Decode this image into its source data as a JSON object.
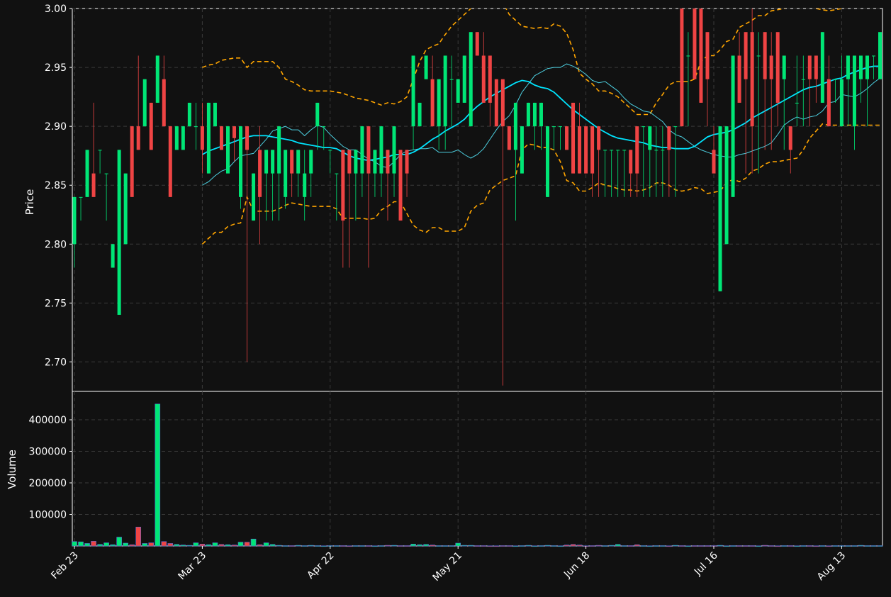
{
  "chart_data": {
    "type": "candlestick",
    "colors": {
      "background": "#111111",
      "up": "#00e676",
      "down": "#ef4444",
      "ma_fast": "#00e5ff",
      "ma_slow": "#4dd0e1",
      "bands": "#ffa500",
      "grid": "#3a3a3a",
      "axis": "#ffffff"
    },
    "x_ticks": [
      "Feb 23",
      "Mar 23",
      "Apr 22",
      "May 21",
      "Jun 18",
      "Jul 16",
      "Aug 13"
    ],
    "x_tick_index": [
      0,
      20,
      40,
      60,
      80,
      100,
      120
    ],
    "price_axis": {
      "label": "Price",
      "ylim": [
        2.675,
        3.0
      ],
      "ticks": [
        "2.70",
        "2.75",
        "2.80",
        "2.85",
        "2.90",
        "2.95",
        "3.00"
      ],
      "tick_values": [
        2.7,
        2.75,
        2.8,
        2.85,
        2.9,
        2.95,
        3.0
      ]
    },
    "volume_axis": {
      "label": "Volume",
      "ylim": [
        0,
        490000
      ],
      "ticks": [
        "100000",
        "200000",
        "300000",
        "400000"
      ],
      "tick_values": [
        100000,
        200000,
        300000,
        400000
      ]
    },
    "grid": true,
    "n_bars": 127,
    "candles": [
      [
        2.8,
        2.84,
        2.78,
        2.84
      ],
      [
        2.84,
        2.84,
        2.82,
        2.84
      ],
      [
        2.84,
        2.88,
        2.84,
        2.88
      ],
      [
        2.86,
        2.92,
        2.84,
        2.84
      ],
      [
        2.88,
        2.88,
        2.86,
        2.88
      ],
      [
        2.86,
        2.86,
        2.82,
        2.86
      ],
      [
        2.78,
        2.8,
        2.78,
        2.8
      ],
      [
        2.74,
        2.88,
        2.74,
        2.88
      ],
      [
        2.8,
        2.86,
        2.8,
        2.86
      ],
      [
        2.9,
        2.9,
        2.84,
        2.84
      ],
      [
        2.9,
        2.96,
        2.88,
        2.88
      ],
      [
        2.9,
        2.94,
        2.9,
        2.94
      ],
      [
        2.92,
        2.92,
        2.88,
        2.88
      ],
      [
        2.92,
        2.96,
        2.92,
        2.96
      ],
      [
        2.94,
        2.96,
        2.9,
        2.9
      ],
      [
        2.9,
        2.9,
        2.84,
        2.84
      ],
      [
        2.88,
        2.9,
        2.88,
        2.9
      ],
      [
        2.88,
        2.9,
        2.88,
        2.9
      ],
      [
        2.9,
        2.92,
        2.9,
        2.92
      ],
      [
        2.9,
        2.92,
        2.88,
        2.9
      ],
      [
        2.9,
        2.92,
        2.86,
        2.88
      ],
      [
        2.86,
        2.92,
        2.86,
        2.92
      ],
      [
        2.9,
        2.92,
        2.9,
        2.92
      ],
      [
        2.9,
        2.9,
        2.88,
        2.88
      ],
      [
        2.86,
        2.9,
        2.86,
        2.9
      ],
      [
        2.9,
        2.9,
        2.87,
        2.89
      ],
      [
        2.84,
        2.9,
        2.83,
        2.9
      ],
      [
        2.9,
        2.9,
        2.7,
        2.88
      ],
      [
        2.82,
        2.86,
        2.82,
        2.86
      ],
      [
        2.88,
        2.9,
        2.8,
        2.84
      ],
      [
        2.86,
        2.88,
        2.82,
        2.88
      ],
      [
        2.86,
        2.88,
        2.82,
        2.88
      ],
      [
        2.86,
        2.9,
        2.82,
        2.9
      ],
      [
        2.84,
        2.88,
        2.83,
        2.88
      ],
      [
        2.88,
        2.88,
        2.84,
        2.86
      ],
      [
        2.86,
        2.88,
        2.84,
        2.88
      ],
      [
        2.84,
        2.88,
        2.82,
        2.86
      ],
      [
        2.86,
        2.88,
        2.84,
        2.88
      ],
      [
        2.9,
        2.92,
        2.88,
        2.92
      ],
      [
        2.9,
        2.9,
        2.88,
        2.9
      ],
      [
        2.88,
        2.88,
        2.86,
        2.88
      ],
      [
        2.86,
        2.86,
        2.82,
        2.86
      ],
      [
        2.88,
        2.88,
        2.78,
        2.82
      ],
      [
        2.88,
        2.88,
        2.78,
        2.86
      ],
      [
        2.86,
        2.88,
        2.82,
        2.88
      ],
      [
        2.86,
        2.9,
        2.84,
        2.9
      ],
      [
        2.9,
        2.9,
        2.78,
        2.86
      ],
      [
        2.86,
        2.88,
        2.84,
        2.88
      ],
      [
        2.86,
        2.9,
        2.84,
        2.9
      ],
      [
        2.88,
        2.88,
        2.82,
        2.86
      ],
      [
        2.86,
        2.9,
        2.84,
        2.9
      ],
      [
        2.88,
        2.88,
        2.82,
        2.82
      ],
      [
        2.88,
        2.88,
        2.84,
        2.86
      ],
      [
        2.9,
        2.96,
        2.88,
        2.96
      ],
      [
        2.9,
        2.92,
        2.9,
        2.92
      ],
      [
        2.94,
        2.96,
        2.94,
        2.96
      ],
      [
        2.94,
        2.96,
        2.9,
        2.9
      ],
      [
        2.9,
        2.94,
        2.88,
        2.94
      ],
      [
        2.9,
        2.96,
        2.88,
        2.96
      ],
      [
        2.94,
        2.96,
        2.9,
        2.94
      ],
      [
        2.92,
        2.94,
        2.92,
        2.94
      ],
      [
        2.92,
        2.96,
        2.92,
        2.96
      ],
      [
        2.9,
        2.98,
        2.9,
        2.98
      ],
      [
        2.98,
        2.98,
        2.96,
        2.96
      ],
      [
        2.96,
        2.98,
        2.92,
        2.92
      ],
      [
        2.96,
        2.96,
        2.9,
        2.92
      ],
      [
        2.94,
        2.94,
        2.9,
        2.9
      ],
      [
        2.94,
        2.94,
        2.68,
        2.9
      ],
      [
        2.9,
        2.9,
        2.88,
        2.88
      ],
      [
        2.88,
        2.92,
        2.82,
        2.92
      ],
      [
        2.86,
        2.9,
        2.86,
        2.9
      ],
      [
        2.9,
        2.92,
        2.9,
        2.92
      ],
      [
        2.9,
        2.92,
        2.88,
        2.92
      ],
      [
        2.9,
        2.92,
        2.88,
        2.92
      ],
      [
        2.84,
        2.9,
        2.84,
        2.9
      ],
      [
        2.9,
        2.9,
        2.88,
        2.9
      ],
      [
        2.9,
        2.9,
        2.88,
        2.9
      ],
      [
        2.9,
        2.9,
        2.88,
        2.88
      ],
      [
        2.92,
        2.92,
        2.86,
        2.86
      ],
      [
        2.9,
        2.92,
        2.86,
        2.86
      ],
      [
        2.9,
        2.9,
        2.86,
        2.86
      ],
      [
        2.9,
        2.9,
        2.84,
        2.86
      ],
      [
        2.9,
        2.9,
        2.84,
        2.88
      ],
      [
        2.88,
        2.88,
        2.84,
        2.88
      ],
      [
        2.88,
        2.88,
        2.84,
        2.88
      ],
      [
        2.88,
        2.88,
        2.84,
        2.88
      ],
      [
        2.88,
        2.88,
        2.84,
        2.88
      ],
      [
        2.88,
        2.88,
        2.84,
        2.86
      ],
      [
        2.9,
        2.9,
        2.84,
        2.86
      ],
      [
        2.9,
        2.9,
        2.84,
        2.9
      ],
      [
        2.88,
        2.9,
        2.84,
        2.9
      ],
      [
        2.88,
        2.9,
        2.84,
        2.88
      ],
      [
        2.88,
        2.9,
        2.84,
        2.88
      ],
      [
        2.9,
        2.9,
        2.84,
        2.88
      ],
      [
        2.9,
        2.9,
        2.84,
        2.9
      ],
      [
        3.0,
        3.0,
        2.9,
        2.9
      ],
      [
        2.96,
        2.98,
        2.9,
        2.96
      ],
      [
        3.0,
        3.0,
        2.94,
        2.94
      ],
      [
        3.0,
        3.0,
        2.92,
        2.92
      ],
      [
        2.98,
        2.98,
        2.9,
        2.94
      ],
      [
        2.88,
        2.9,
        2.86,
        2.86
      ],
      [
        2.76,
        2.9,
        2.76,
        2.9
      ],
      [
        2.8,
        2.9,
        2.8,
        2.9
      ],
      [
        2.84,
        2.96,
        2.84,
        2.96
      ],
      [
        2.96,
        2.98,
        2.92,
        2.92
      ],
      [
        2.98,
        2.98,
        2.86,
        2.94
      ],
      [
        2.98,
        3.0,
        2.86,
        2.9
      ],
      [
        2.96,
        2.98,
        2.86,
        2.96
      ],
      [
        2.98,
        2.98,
        2.88,
        2.94
      ],
      [
        2.96,
        2.98,
        2.88,
        2.94
      ],
      [
        2.98,
        2.98,
        2.9,
        2.92
      ],
      [
        2.94,
        2.96,
        2.88,
        2.96
      ],
      [
        2.9,
        2.9,
        2.86,
        2.88
      ],
      [
        2.92,
        2.96,
        2.9,
        2.92
      ],
      [
        2.94,
        2.96,
        2.9,
        2.94
      ],
      [
        2.96,
        2.96,
        2.9,
        2.94
      ],
      [
        2.96,
        2.96,
        2.92,
        2.94
      ],
      [
        2.92,
        2.98,
        2.92,
        2.98
      ],
      [
        2.94,
        2.96,
        2.9,
        2.9
      ],
      [
        2.94,
        2.94,
        2.92,
        2.94
      ],
      [
        2.9,
        2.96,
        2.9,
        2.94
      ],
      [
        2.94,
        2.96,
        2.9,
        2.96
      ],
      [
        2.9,
        2.96,
        2.88,
        2.96
      ],
      [
        2.94,
        2.96,
        2.92,
        2.96
      ],
      [
        2.94,
        2.96,
        2.9,
        2.96
      ],
      [
        2.96,
        2.96,
        2.94,
        2.96
      ],
      [
        2.94,
        2.98,
        2.94,
        2.98
      ]
    ],
    "volume": [
      14000,
      13000,
      8000,
      15000,
      5000,
      10000,
      4000,
      28000,
      9000,
      4000,
      60000,
      8000,
      10000,
      450000,
      14000,
      8000,
      5000,
      3000,
      2000,
      10000,
      6000,
      4000,
      10000,
      5000,
      4000,
      3000,
      12000,
      12000,
      22000,
      4000,
      10000,
      5000,
      2000,
      1000,
      1000,
      2000,
      1000,
      2000,
      1000,
      500,
      1000,
      1000,
      1000,
      500,
      1000,
      1000,
      1000,
      500,
      1000,
      2000,
      2000,
      1000,
      1000,
      6000,
      4000,
      5000,
      3000,
      1000,
      1000,
      1000,
      9000,
      2000,
      2000,
      1000,
      1000,
      500,
      500,
      1000,
      1000,
      500,
      1000,
      2000,
      500,
      1000,
      2000,
      1000,
      500,
      3000,
      5000,
      3000,
      500,
      1000,
      2000,
      1000,
      2000,
      5000,
      1000,
      1000,
      4000,
      1000,
      500,
      1000,
      1000,
      500,
      2000,
      1000,
      500,
      1000,
      1000,
      1000,
      1000,
      2000,
      500,
      1000,
      1000,
      1000,
      1000,
      500,
      2000,
      1000,
      500,
      1000,
      1000,
      500,
      1000,
      1000,
      500,
      1000,
      500,
      1000,
      1000,
      1000,
      1000,
      2000,
      1000,
      1000,
      1000
    ],
    "ma_fast": [
      null,
      null,
      null,
      null,
      null,
      null,
      null,
      null,
      null,
      null,
      null,
      null,
      null,
      null,
      null,
      null,
      null,
      null,
      null,
      null,
      2.876,
      2.879,
      2.881,
      2.883,
      2.885,
      2.887,
      2.889,
      2.891,
      2.892,
      2.892,
      2.892,
      2.891,
      2.89,
      2.889,
      2.888,
      2.886,
      2.885,
      2.884,
      2.883,
      2.882,
      2.882,
      2.881,
      2.878,
      2.875,
      2.873,
      2.872,
      2.871,
      2.872,
      2.873,
      2.874,
      2.876,
      2.876,
      2.876,
      2.878,
      2.881,
      2.885,
      2.889,
      2.892,
      2.896,
      2.899,
      2.902,
      2.906,
      2.912,
      2.917,
      2.921,
      2.925,
      2.928,
      2.931,
      2.934,
      2.937,
      2.939,
      2.938,
      2.935,
      2.933,
      2.932,
      2.929,
      2.924,
      2.919,
      2.914,
      2.91,
      2.906,
      2.902,
      2.898,
      2.895,
      2.892,
      2.89,
      2.889,
      2.888,
      2.887,
      2.886,
      2.884,
      2.883,
      2.882,
      2.882,
      2.881,
      2.881,
      2.881,
      2.883,
      2.887,
      2.891,
      2.893,
      2.894,
      2.895,
      2.897,
      2.9,
      2.903,
      2.907,
      2.91,
      2.913,
      2.916,
      2.919,
      2.922,
      2.925,
      2.928,
      2.931,
      2.933,
      2.934,
      2.936,
      2.938,
      2.94,
      2.941,
      2.944,
      2.946,
      2.948,
      2.95,
      2.951,
      2.951
    ],
    "ma_slow": [
      null,
      null,
      null,
      null,
      null,
      null,
      null,
      null,
      null,
      null,
      null,
      null,
      null,
      null,
      null,
      null,
      null,
      null,
      null,
      null,
      2.85,
      2.853,
      2.858,
      2.862,
      2.864,
      2.87,
      2.875,
      2.876,
      2.877,
      2.883,
      2.889,
      2.896,
      2.898,
      2.9,
      2.897,
      2.897,
      2.892,
      2.897,
      2.901,
      2.899,
      2.893,
      2.888,
      2.883,
      2.88,
      2.88,
      2.876,
      2.872,
      2.87,
      2.866,
      2.865,
      2.87,
      2.876,
      2.879,
      2.88,
      2.881,
      2.881,
      2.882,
      2.878,
      2.878,
      2.878,
      2.88,
      2.876,
      2.873,
      2.876,
      2.881,
      2.889,
      2.897,
      2.904,
      2.909,
      2.918,
      2.929,
      2.936,
      2.943,
      2.946,
      2.949,
      2.95,
      2.95,
      2.953,
      2.951,
      2.948,
      2.944,
      2.939,
      2.937,
      2.938,
      2.934,
      2.93,
      2.924,
      2.919,
      2.916,
      2.913,
      2.912,
      2.908,
      2.904,
      2.897,
      2.893,
      2.891,
      2.887,
      2.883,
      2.88,
      2.878,
      2.876,
      2.875,
      2.874,
      2.874,
      2.876,
      2.877,
      2.879,
      2.881,
      2.883,
      2.886,
      2.893,
      2.901,
      2.905,
      2.908,
      2.906,
      2.908,
      2.909,
      2.913,
      2.92,
      2.921,
      2.927,
      2.926,
      2.925,
      2.928,
      2.932,
      2.937,
      2.941
    ],
    "band_upper": [
      null,
      null,
      null,
      null,
      null,
      null,
      null,
      null,
      null,
      null,
      null,
      null,
      null,
      null,
      null,
      null,
      null,
      null,
      null,
      null,
      2.95,
      2.952,
      2.953,
      2.956,
      2.957,
      2.958,
      2.958,
      2.95,
      2.955,
      2.955,
      2.955,
      2.955,
      2.95,
      2.94,
      2.938,
      2.935,
      2.931,
      2.93,
      2.93,
      2.93,
      2.93,
      2.929,
      2.928,
      2.926,
      2.924,
      2.923,
      2.922,
      2.92,
      2.918,
      2.92,
      2.919,
      2.921,
      2.925,
      2.94,
      2.955,
      2.965,
      2.968,
      2.97,
      2.978,
      2.985,
      2.99,
      2.995,
      3.0,
      3.005,
      3.01,
      3.014,
      3.012,
      3.005,
      2.995,
      2.99,
      2.985,
      2.984,
      2.983,
      2.984,
      2.983,
      2.987,
      2.985,
      2.979,
      2.965,
      2.945,
      2.94,
      2.936,
      2.93,
      2.93,
      2.928,
      2.925,
      2.92,
      2.915,
      2.91,
      2.91,
      2.91,
      2.92,
      2.927,
      2.935,
      2.938,
      2.938,
      2.938,
      2.94,
      2.955,
      2.96,
      2.96,
      2.965,
      2.972,
      2.974,
      2.984,
      2.987,
      2.99,
      2.994,
      2.994,
      2.998,
      2.999,
      3.0,
      3.002,
      3.004,
      3.006,
      3.004,
      3.0,
      2.999,
      2.998,
      2.999,
      3.0,
      3.001,
      3.002,
      3.003,
      3.003,
      3.003,
      3.003
    ],
    "band_lower": [
      null,
      null,
      null,
      null,
      null,
      null,
      null,
      null,
      null,
      null,
      null,
      null,
      null,
      null,
      null,
      null,
      null,
      null,
      null,
      null,
      2.8,
      2.805,
      2.81,
      2.81,
      2.815,
      2.817,
      2.818,
      2.84,
      2.828,
      2.828,
      2.828,
      2.828,
      2.83,
      2.833,
      2.835,
      2.834,
      2.833,
      2.832,
      2.832,
      2.832,
      2.832,
      2.83,
      2.822,
      2.822,
      2.822,
      2.822,
      2.821,
      2.822,
      2.829,
      2.832,
      2.836,
      2.836,
      2.826,
      2.816,
      2.812,
      2.81,
      2.814,
      2.814,
      2.811,
      2.811,
      2.811,
      2.814,
      2.828,
      2.833,
      2.835,
      2.846,
      2.85,
      2.854,
      2.856,
      2.858,
      2.88,
      2.885,
      2.884,
      2.882,
      2.882,
      2.88,
      2.87,
      2.854,
      2.852,
      2.845,
      2.845,
      2.848,
      2.852,
      2.85,
      2.849,
      2.847,
      2.846,
      2.846,
      2.845,
      2.846,
      2.848,
      2.852,
      2.852,
      2.85,
      2.846,
      2.845,
      2.846,
      2.848,
      2.847,
      2.843,
      2.844,
      2.845,
      2.852,
      2.855,
      2.853,
      2.856,
      2.862,
      2.864,
      2.868,
      2.87,
      2.87,
      2.871,
      2.872,
      2.873,
      2.88,
      2.89,
      2.896,
      2.902,
      2.901,
      2.901,
      2.901,
      2.901,
      2.901,
      2.901,
      2.901,
      2.901,
      2.901
    ]
  }
}
